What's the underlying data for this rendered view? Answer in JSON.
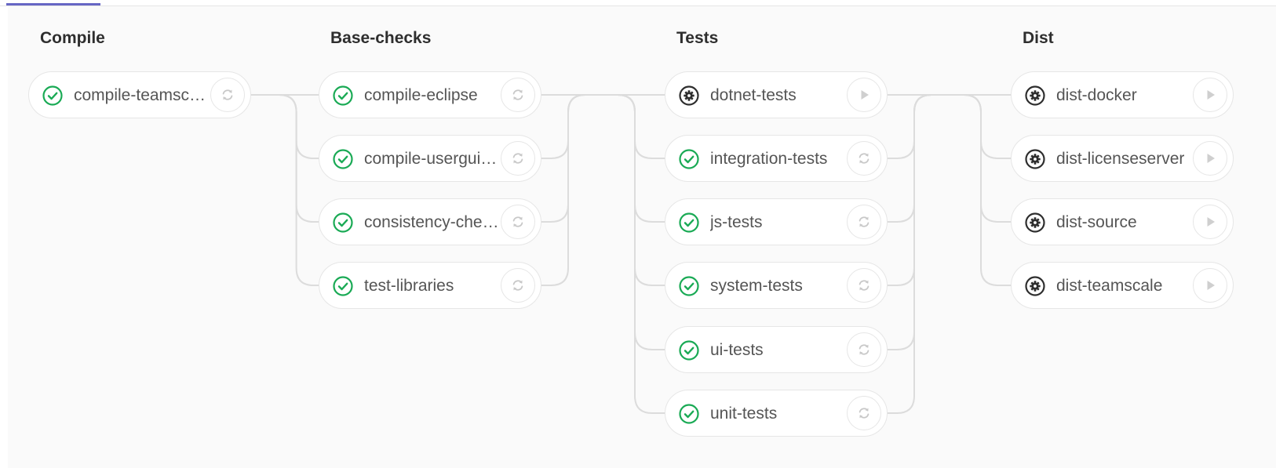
{
  "colors": {
    "success": "#1aaa55",
    "manual": "#2e2e2e",
    "connector": "#dcdcdc",
    "tab_accent": "#6666c4"
  },
  "stages": [
    {
      "title": "Compile",
      "jobs": [
        {
          "name": "compile-teamsc…",
          "status": "success",
          "status_icon": "check-circle-icon",
          "action_icon": "retry-icon"
        }
      ]
    },
    {
      "title": "Base-checks",
      "jobs": [
        {
          "name": "compile-eclipse",
          "status": "success",
          "status_icon": "check-circle-icon",
          "action_icon": "retry-icon"
        },
        {
          "name": "compile-usergui…",
          "status": "success",
          "status_icon": "check-circle-icon",
          "action_icon": "retry-icon"
        },
        {
          "name": "consistency-che…",
          "status": "success",
          "status_icon": "check-circle-icon",
          "action_icon": "retry-icon"
        },
        {
          "name": "test-libraries",
          "status": "success",
          "status_icon": "check-circle-icon",
          "action_icon": "retry-icon"
        }
      ]
    },
    {
      "title": "Tests",
      "jobs": [
        {
          "name": "dotnet-tests",
          "status": "manual",
          "status_icon": "gear-circle-icon",
          "action_icon": "play-icon"
        },
        {
          "name": "integration-tests",
          "status": "success",
          "status_icon": "check-circle-icon",
          "action_icon": "retry-icon"
        },
        {
          "name": "js-tests",
          "status": "success",
          "status_icon": "check-circle-icon",
          "action_icon": "retry-icon"
        },
        {
          "name": "system-tests",
          "status": "success",
          "status_icon": "check-circle-icon",
          "action_icon": "retry-icon"
        },
        {
          "name": "ui-tests",
          "status": "success",
          "status_icon": "check-circle-icon",
          "action_icon": "retry-icon"
        },
        {
          "name": "unit-tests",
          "status": "success",
          "status_icon": "check-circle-icon",
          "action_icon": "retry-icon"
        }
      ]
    },
    {
      "title": "Dist",
      "jobs": [
        {
          "name": "dist-docker",
          "status": "manual",
          "status_icon": "gear-circle-icon",
          "action_icon": "play-icon"
        },
        {
          "name": "dist-licenseserver",
          "status": "manual",
          "status_icon": "gear-circle-icon",
          "action_icon": "play-icon"
        },
        {
          "name": "dist-source",
          "status": "manual",
          "status_icon": "gear-circle-icon",
          "action_icon": "play-icon"
        },
        {
          "name": "dist-teamscale",
          "status": "manual",
          "status_icon": "gear-circle-icon",
          "action_icon": "play-icon"
        }
      ]
    }
  ]
}
